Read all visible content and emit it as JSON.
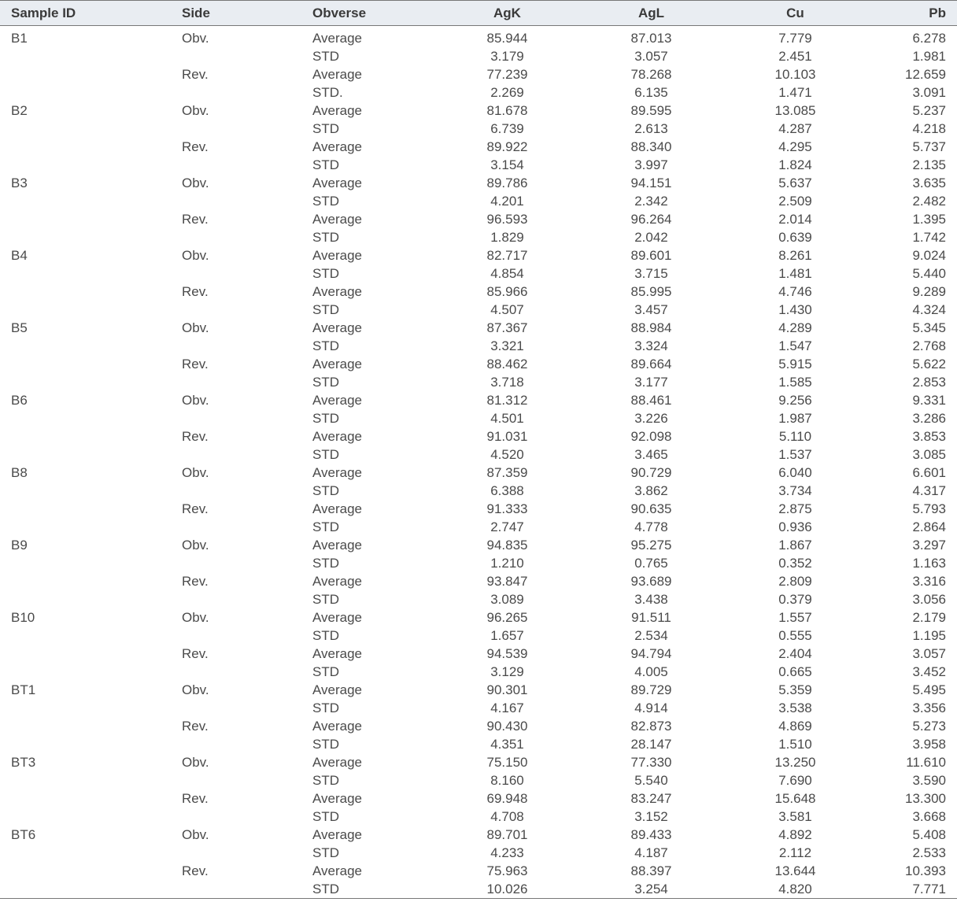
{
  "table": {
    "headers": [
      "Sample ID",
      "Side",
      "Obverse",
      "AgK",
      "AgL",
      "Cu",
      "Pb"
    ],
    "rows": [
      [
        "B1",
        "Obv.",
        "Average",
        "85.944",
        "87.013",
        "7.779",
        "6.278"
      ],
      [
        "",
        "",
        "STD",
        "3.179",
        "3.057",
        "2.451",
        "1.981"
      ],
      [
        "",
        "Rev.",
        "Average",
        "77.239",
        "78.268",
        "10.103",
        "12.659"
      ],
      [
        "",
        "",
        "STD.",
        "2.269",
        "6.135",
        "1.471",
        "3.091"
      ],
      [
        "B2",
        "Obv.",
        "Average",
        "81.678",
        "89.595",
        "13.085",
        "5.237"
      ],
      [
        "",
        "",
        "STD",
        "6.739",
        "2.613",
        "4.287",
        "4.218"
      ],
      [
        "",
        "Rev.",
        "Average",
        "89.922",
        "88.340",
        "4.295",
        "5.737"
      ],
      [
        "",
        "",
        "STD",
        "3.154",
        "3.997",
        "1.824",
        "2.135"
      ],
      [
        "B3",
        "Obv.",
        "Average",
        "89.786",
        "94.151",
        "5.637",
        "3.635"
      ],
      [
        "",
        "",
        "STD",
        "4.201",
        "2.342",
        "2.509",
        "2.482"
      ],
      [
        "",
        "Rev.",
        "Average",
        "96.593",
        "96.264",
        "2.014",
        "1.395"
      ],
      [
        "",
        "",
        "STD",
        "1.829",
        "2.042",
        "0.639",
        "1.742"
      ],
      [
        "B4",
        "Obv.",
        "Average",
        "82.717",
        "89.601",
        "8.261",
        "9.024"
      ],
      [
        "",
        "",
        "STD",
        "4.854",
        "3.715",
        "1.481",
        "5.440"
      ],
      [
        "",
        "Rev.",
        "Average",
        "85.966",
        "85.995",
        "4.746",
        "9.289"
      ],
      [
        "",
        "",
        "STD",
        "4.507",
        "3.457",
        "1.430",
        "4.324"
      ],
      [
        "B5",
        "Obv.",
        "Average",
        "87.367",
        "88.984",
        "4.289",
        "5.345"
      ],
      [
        "",
        "",
        "STD",
        "3.321",
        "3.324",
        "1.547",
        "2.768"
      ],
      [
        "",
        "Rev.",
        "Average",
        "88.462",
        "89.664",
        "5.915",
        "5.622"
      ],
      [
        "",
        "",
        "STD",
        "3.718",
        "3.177",
        "1.585",
        "2.853"
      ],
      [
        "B6",
        "Obv.",
        "Average",
        "81.312",
        "88.461",
        "9.256",
        "9.331"
      ],
      [
        "",
        "",
        "STD",
        "4.501",
        "3.226",
        "1.987",
        "3.286"
      ],
      [
        "",
        "Rev.",
        "Average",
        "91.031",
        "92.098",
        "5.110",
        "3.853"
      ],
      [
        "",
        "",
        "STD",
        "4.520",
        "3.465",
        "1.537",
        "3.085"
      ],
      [
        "B8",
        "Obv.",
        "Average",
        "87.359",
        "90.729",
        "6.040",
        "6.601"
      ],
      [
        "",
        "",
        "STD",
        "6.388",
        "3.862",
        "3.734",
        "4.317"
      ],
      [
        "",
        "Rev.",
        "Average",
        "91.333",
        "90.635",
        "2.875",
        "5.793"
      ],
      [
        "",
        "",
        "STD",
        "2.747",
        "4.778",
        "0.936",
        "2.864"
      ],
      [
        "B9",
        "Obv.",
        "Average",
        "94.835",
        "95.275",
        "1.867",
        "3.297"
      ],
      [
        "",
        "",
        "STD",
        "1.210",
        "0.765",
        "0.352",
        "1.163"
      ],
      [
        "",
        "Rev.",
        "Average",
        "93.847",
        "93.689",
        "2.809",
        "3.316"
      ],
      [
        "",
        "",
        "STD",
        "3.089",
        "3.438",
        "0.379",
        "3.056"
      ],
      [
        "B10",
        "Obv.",
        "Average",
        "96.265",
        "91.511",
        "1.557",
        "2.179"
      ],
      [
        "",
        "",
        "STD",
        "1.657",
        "2.534",
        "0.555",
        "1.195"
      ],
      [
        "",
        "Rev.",
        "Average",
        "94.539",
        "94.794",
        "2.404",
        "3.057"
      ],
      [
        "",
        "",
        "STD",
        "3.129",
        "4.005",
        "0.665",
        "3.452"
      ],
      [
        "BT1",
        "Obv.",
        "Average",
        "90.301",
        "89.729",
        "5.359",
        "5.495"
      ],
      [
        "",
        "",
        "STD",
        "4.167",
        "4.914",
        "3.538",
        "3.356"
      ],
      [
        "",
        "Rev.",
        "Average",
        "90.430",
        "82.873",
        "4.869",
        "5.273"
      ],
      [
        "",
        "",
        "STD",
        "4.351",
        "28.147",
        "1.510",
        "3.958"
      ],
      [
        "BT3",
        "Obv.",
        "Average",
        "75.150",
        "77.330",
        "13.250",
        "11.610"
      ],
      [
        "",
        "",
        "STD",
        "8.160",
        "5.540",
        "7.690",
        "3.590"
      ],
      [
        "",
        "Rev.",
        "Average",
        "69.948",
        "83.247",
        "15.648",
        "13.300"
      ],
      [
        "",
        "",
        "STD",
        "4.708",
        "3.152",
        "3.581",
        "3.668"
      ],
      [
        "BT6",
        "Obv.",
        "Average",
        "89.701",
        "89.433",
        "4.892",
        "5.408"
      ],
      [
        "",
        "",
        "STD",
        "4.233",
        "4.187",
        "2.112",
        "2.533"
      ],
      [
        "",
        "Rev.",
        "Average",
        "75.963",
        "88.397",
        "13.644",
        "10.393"
      ],
      [
        "",
        "",
        "STD",
        "10.026",
        "3.254",
        "4.820",
        "7.771"
      ]
    ]
  }
}
